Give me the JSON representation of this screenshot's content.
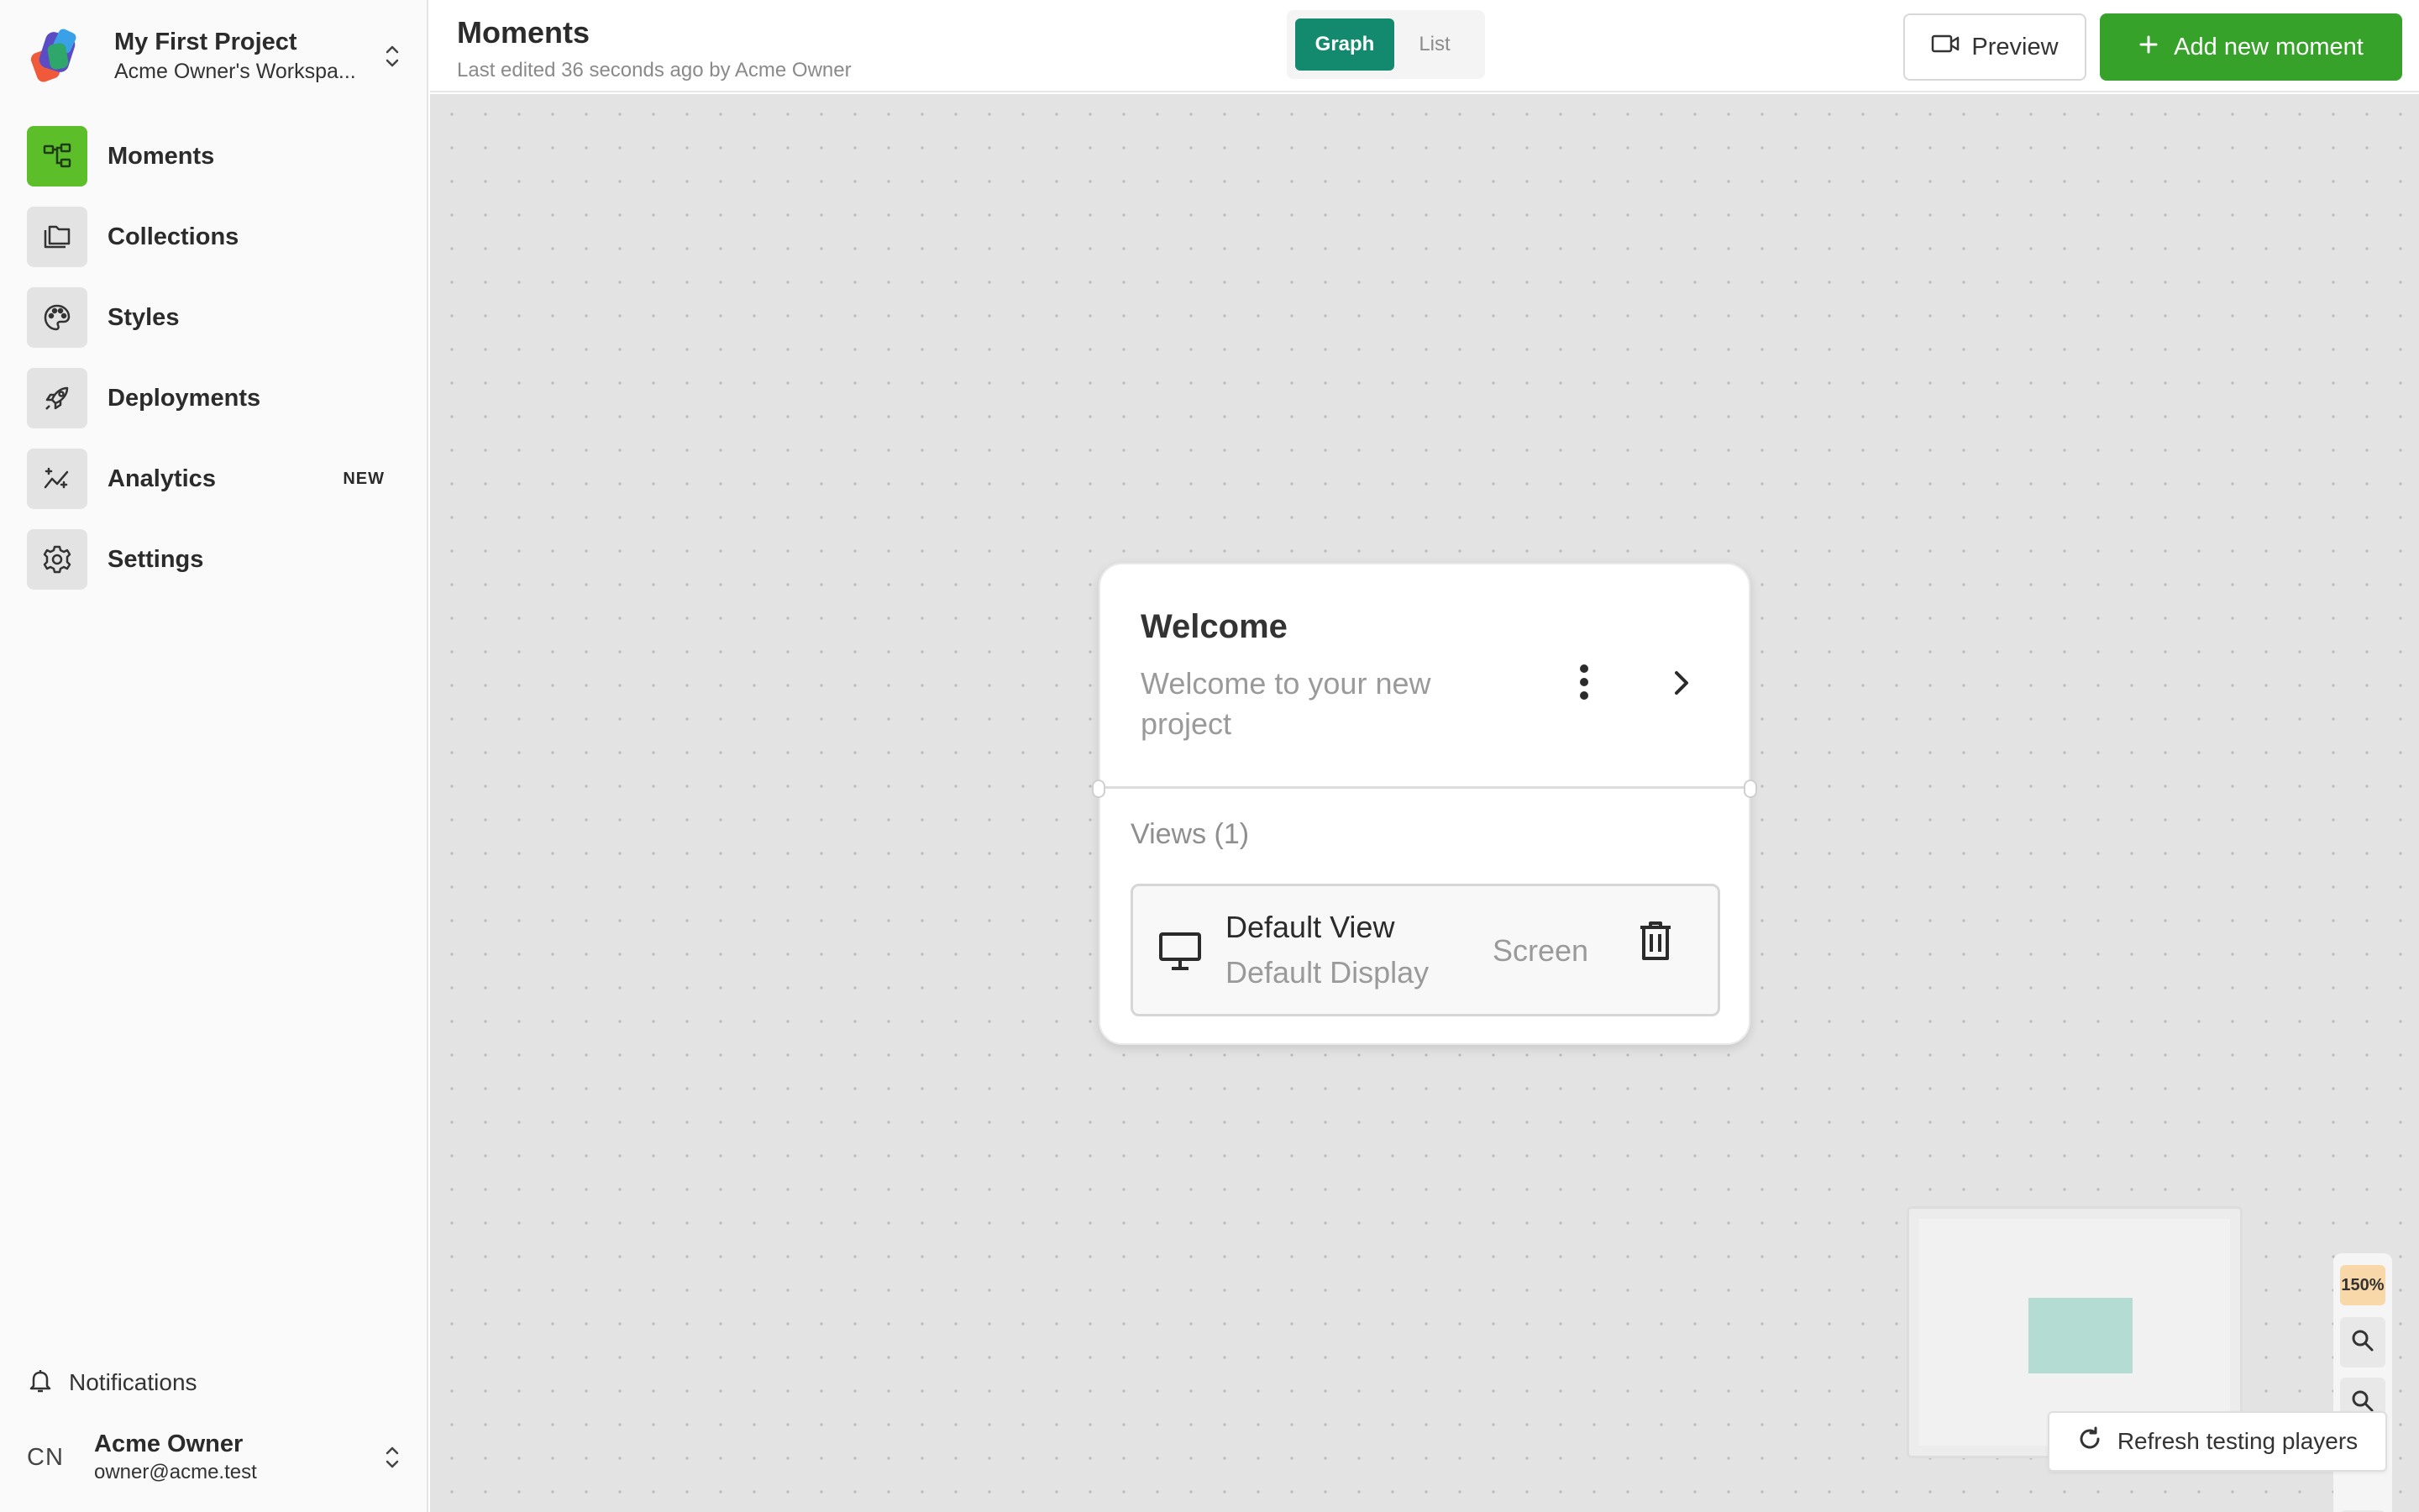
{
  "project": {
    "name": "My First Project",
    "workspace": "Acme Owner's Workspa..."
  },
  "sidebar": {
    "items": [
      {
        "label": "Moments",
        "icon": "moments-icon",
        "active": true
      },
      {
        "label": "Collections",
        "icon": "collections-icon"
      },
      {
        "label": "Styles",
        "icon": "palette-icon"
      },
      {
        "label": "Deployments",
        "icon": "rocket-icon"
      },
      {
        "label": "Analytics",
        "icon": "analytics-icon",
        "badge": "NEW"
      },
      {
        "label": "Settings",
        "icon": "gear-icon"
      }
    ],
    "notifications_label": "Notifications"
  },
  "user": {
    "initials": "CN",
    "name": "Acme Owner",
    "email": "owner@acme.test"
  },
  "header": {
    "title": "Moments",
    "subtitle": "Last edited 36 seconds ago by Acme Owner",
    "toggle": {
      "graph": "Graph",
      "list": "List",
      "selected": "Graph"
    },
    "preview_label": "Preview",
    "add_label": "Add new moment"
  },
  "moment": {
    "title": "Welcome",
    "description": "Welcome to your new project",
    "views_label": "Views (1)",
    "view": {
      "name": "Default View",
      "display": "Default Display",
      "type": "Screen",
      "icon": "monitor-icon"
    }
  },
  "zoom": {
    "level": "150%"
  },
  "refresh_label": "Refresh testing players",
  "colors": {
    "accent_green": "#36a22a",
    "nav_active": "#5cbf2a",
    "toggle_active": "#138a6e",
    "zoom_badge": "#f8d7a8"
  }
}
